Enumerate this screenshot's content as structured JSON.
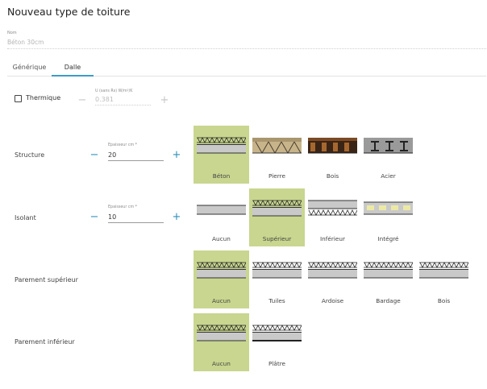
{
  "title": "Nouveau type de toiture",
  "name_field": {
    "label": "Nom",
    "placeholder": "Béton 30cm"
  },
  "tabs": [
    {
      "label": "Générique"
    },
    {
      "label": "Dalle"
    }
  ],
  "active_tab": "Dalle",
  "thermal": {
    "checkbox_label": "Thermique",
    "checked": false,
    "u_label": "U (sans Rs) W/m²/K",
    "u_value": "0.381"
  },
  "structure": {
    "label": "Structure",
    "thickness_label": "Epaisseur cm *",
    "thickness_value": "20",
    "options": [
      {
        "label": "Béton",
        "icon": "concrete-slab-icon",
        "selected": true
      },
      {
        "label": "Pierre",
        "icon": "stone-vault-slab-icon",
        "selected": false
      },
      {
        "label": "Bois",
        "icon": "wood-joist-slab-icon",
        "selected": false
      },
      {
        "label": "Acier",
        "icon": "steel-beam-slab-icon",
        "selected": false
      }
    ]
  },
  "insulation": {
    "label": "Isolant",
    "thickness_label": "Epaisseur cm *",
    "thickness_value": "10",
    "options": [
      {
        "label": "Aucun",
        "icon": "plain-slab-icon",
        "selected": false
      },
      {
        "label": "Supérieur",
        "icon": "top-insulation-icon",
        "selected": true
      },
      {
        "label": "Inférieur",
        "icon": "bottom-insulation-icon",
        "selected": false
      },
      {
        "label": "Intégré",
        "icon": "integrated-insulation-icon",
        "selected": false
      }
    ]
  },
  "upper_facing": {
    "label": "Parement supérieur",
    "options": [
      {
        "label": "Aucun",
        "icon": "no-facing-icon",
        "selected": true
      },
      {
        "label": "Tuiles",
        "icon": "tiles-facing-icon",
        "selected": false
      },
      {
        "label": "Ardoise",
        "icon": "slate-facing-icon",
        "selected": false
      },
      {
        "label": "Bardage",
        "icon": "cladding-facing-icon",
        "selected": false
      },
      {
        "label": "Bois",
        "icon": "wood-facing-icon",
        "selected": false
      }
    ]
  },
  "lower_facing": {
    "label": "Parement inférieur",
    "options": [
      {
        "label": "Aucun",
        "icon": "no-facing-icon",
        "selected": true
      },
      {
        "label": "Plâtre",
        "icon": "plaster-facing-icon",
        "selected": false
      }
    ]
  },
  "colors": {
    "accent": "#2e8fb8",
    "selected_bg": "#c8d68f",
    "tab_underline": "#3c9bc6"
  }
}
